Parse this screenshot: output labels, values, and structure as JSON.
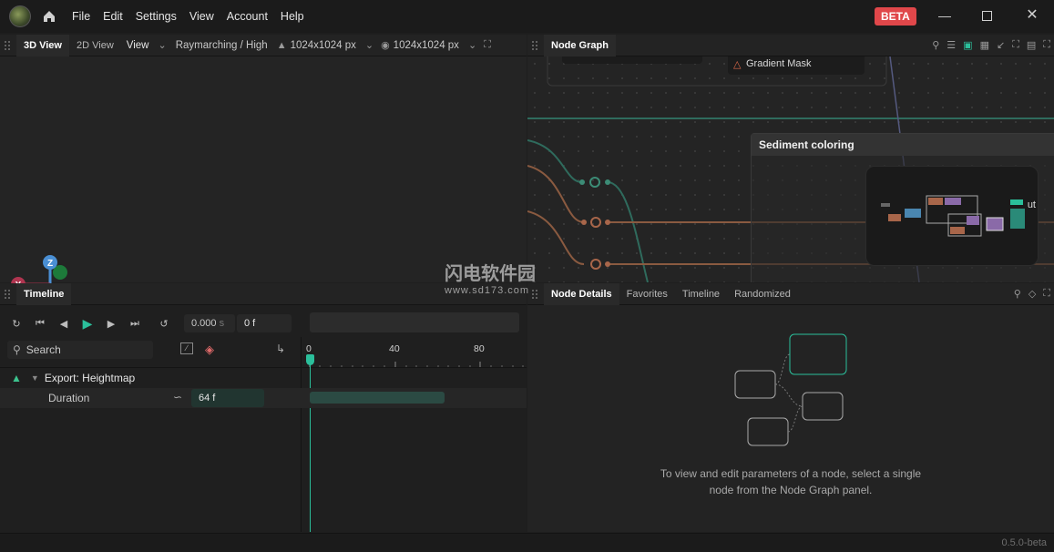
{
  "titlebar": {
    "menu": [
      "File",
      "Edit",
      "Settings",
      "View",
      "Account",
      "Help"
    ],
    "badge": "BETA",
    "window_controls": [
      "minimize",
      "maximize",
      "close"
    ]
  },
  "view3d": {
    "tabs": [
      "3D View",
      "2D View"
    ],
    "view_menu": "View",
    "render_mode": "Raymarching / High",
    "resolution_a": "1024x1024 px",
    "resolution_b": "1024x1024 px",
    "axes": [
      "Z",
      "X",
      "Y"
    ]
  },
  "nodegraph": {
    "tab": "Node Graph",
    "node_gradient_mask": "Gradient Mask",
    "frame_title": "Sediment coloring",
    "minimap_text": "ut"
  },
  "timeline": {
    "tab": "Timeline",
    "time_seconds": "0.000",
    "time_unit": "s",
    "frame": "0 f",
    "search_placeholder": "Search",
    "ruler": [
      "0",
      "40",
      "80"
    ],
    "track_name": "Export: Heightmap",
    "param_name": "Duration",
    "param_value": "64 f"
  },
  "details": {
    "tabs": [
      "Node Details",
      "Favorites",
      "Timeline",
      "Randomized"
    ],
    "hint_line1": "To view and edit parameters of a node, select a single",
    "hint_line2": "node from the Node Graph panel."
  },
  "status": {
    "version": "0.5.0-beta"
  },
  "watermark": {
    "title": "闪电软件园",
    "url": "www.sd173.com"
  },
  "colors": {
    "accent": "#2bbf9b",
    "beta": "#e0474a"
  }
}
